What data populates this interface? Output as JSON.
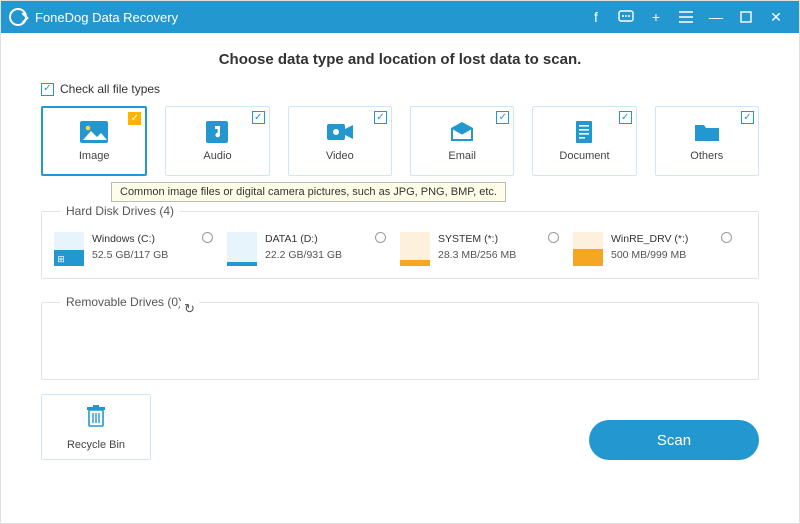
{
  "app": {
    "title": "FoneDog Data Recovery"
  },
  "heading": "Choose data type and location of lost data to scan.",
  "checkAllLabel": "Check all file types",
  "types": [
    {
      "label": "Image"
    },
    {
      "label": "Audio"
    },
    {
      "label": "Video"
    },
    {
      "label": "Email"
    },
    {
      "label": "Document"
    },
    {
      "label": "Others"
    }
  ],
  "tooltip": "Common image files or digital camera pictures, such as JPG, PNG, BMP, etc.",
  "hdd": {
    "legend": "Hard Disk Drives (4)",
    "drives": [
      {
        "name": "Windows (C:)",
        "size": "52.5 GB/117 GB",
        "usedColor": "#2398d0",
        "os": true
      },
      {
        "name": "DATA1 (D:)",
        "size": "22.2 GB/931 GB",
        "usedColor": "#2398d0",
        "os": false
      },
      {
        "name": "SYSTEM (*:)",
        "size": "28.3 MB/256 MB",
        "usedColor": "#f5a623",
        "os": false
      },
      {
        "name": "WinRE_DRV (*:)",
        "size": "500 MB/999 MB",
        "usedColor": "#f5a623",
        "os": false
      }
    ]
  },
  "removable": {
    "legend": "Removable Drives (0)"
  },
  "recycle": {
    "label": "Recycle Bin"
  },
  "scan": {
    "label": "Scan"
  }
}
